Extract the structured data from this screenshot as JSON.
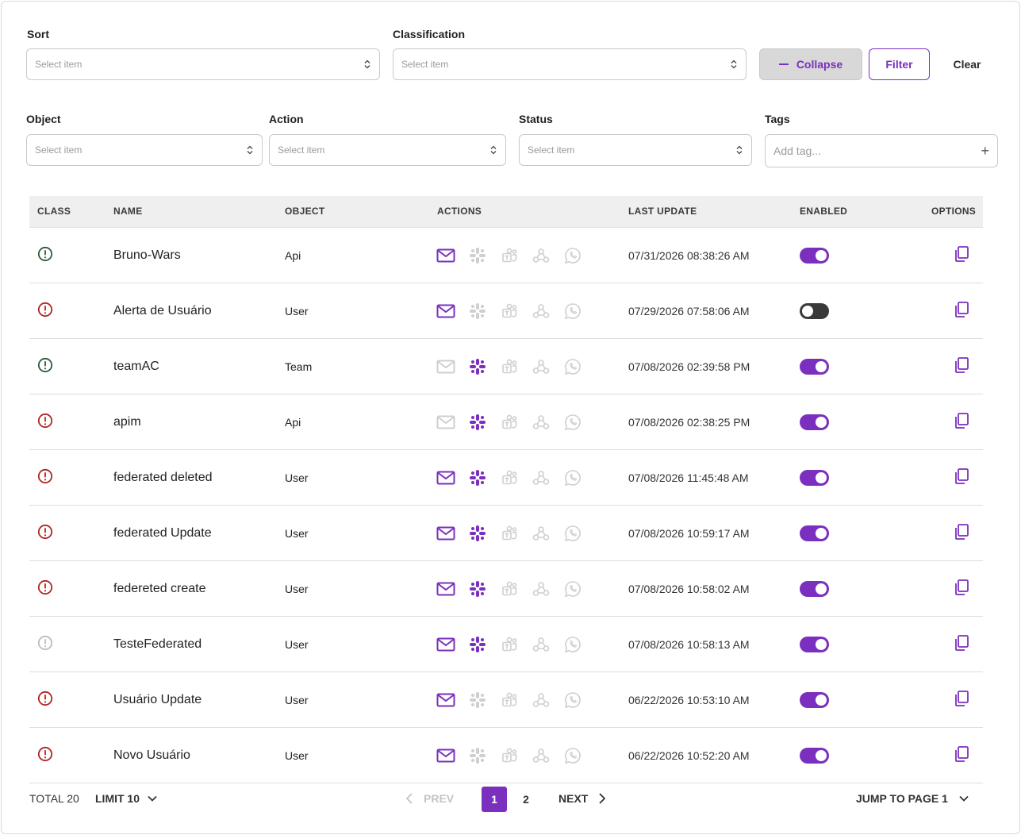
{
  "colors": {
    "accent": "#7b2fbe",
    "class_green": "#2f5a3a",
    "class_red": "#b22424",
    "class_gray": "#bdbdbd",
    "inactive_icon": "#cfcfcf"
  },
  "filters": {
    "sort": {
      "label": "Sort",
      "placeholder": "Select item"
    },
    "classification": {
      "label": "Classification",
      "placeholder": "Select item"
    },
    "object": {
      "label": "Object",
      "placeholder": "Select item"
    },
    "action": {
      "label": "Action",
      "placeholder": "Select item"
    },
    "status": {
      "label": "Status",
      "placeholder": "Select item"
    },
    "tags": {
      "label": "Tags",
      "placeholder": "Add tag..."
    }
  },
  "buttons": {
    "collapse": "Collapse",
    "filter": "Filter",
    "clear": "Clear"
  },
  "table": {
    "headers": {
      "class": "CLASS",
      "name": "NAME",
      "object": "OBJECT",
      "actions": "ACTIONS",
      "last_update": "LAST UPDATE",
      "enabled": "ENABLED",
      "options": "OPTIONS"
    },
    "rows": [
      {
        "class": "green",
        "name": "Bruno-Wars",
        "object": "Api",
        "email": true,
        "slack": false,
        "teams": false,
        "webhook": false,
        "whatsapp": false,
        "last_update": "07/31/2026 08:38:26 AM",
        "enabled": true
      },
      {
        "class": "red",
        "name": "Alerta de Usuário",
        "object": "User",
        "email": true,
        "slack": false,
        "teams": false,
        "webhook": false,
        "whatsapp": false,
        "last_update": "07/29/2026 07:58:06 AM",
        "enabled": false
      },
      {
        "class": "green",
        "name": "teamAC",
        "object": "Team",
        "email": false,
        "slack": true,
        "teams": false,
        "webhook": false,
        "whatsapp": false,
        "last_update": "07/08/2026 02:39:58 PM",
        "enabled": true
      },
      {
        "class": "red",
        "name": "apim",
        "object": "Api",
        "email": false,
        "slack": true,
        "teams": false,
        "webhook": false,
        "whatsapp": false,
        "last_update": "07/08/2026 02:38:25 PM",
        "enabled": true
      },
      {
        "class": "red",
        "name": "federated deleted",
        "object": "User",
        "email": true,
        "slack": true,
        "teams": false,
        "webhook": false,
        "whatsapp": false,
        "last_update": "07/08/2026 11:45:48 AM",
        "enabled": true
      },
      {
        "class": "red",
        "name": "federated Update",
        "object": "User",
        "email": true,
        "slack": true,
        "teams": false,
        "webhook": false,
        "whatsapp": false,
        "last_update": "07/08/2026 10:59:17 AM",
        "enabled": true
      },
      {
        "class": "red",
        "name": "federeted create",
        "object": "User",
        "email": true,
        "slack": true,
        "teams": false,
        "webhook": false,
        "whatsapp": false,
        "last_update": "07/08/2026 10:58:02 AM",
        "enabled": true
      },
      {
        "class": "gray",
        "name": "TesteFederated",
        "object": "User",
        "email": true,
        "slack": true,
        "teams": false,
        "webhook": false,
        "whatsapp": false,
        "last_update": "07/08/2026 10:58:13 AM",
        "enabled": true
      },
      {
        "class": "red",
        "name": "Usuário Update",
        "object": "User",
        "email": true,
        "slack": false,
        "teams": false,
        "webhook": false,
        "whatsapp": false,
        "last_update": "06/22/2026 10:53:10 AM",
        "enabled": true
      },
      {
        "class": "red",
        "name": "Novo Usuário",
        "object": "User",
        "email": true,
        "slack": false,
        "teams": false,
        "webhook": false,
        "whatsapp": false,
        "last_update": "06/22/2026 10:52:20 AM",
        "enabled": true
      }
    ]
  },
  "pagination": {
    "total": "TOTAL 20",
    "limit": "LIMIT 10",
    "prev": "PREV",
    "pages": [
      "1",
      "2"
    ],
    "current": "1",
    "next": "NEXT",
    "jump": "JUMP TO PAGE 1"
  }
}
